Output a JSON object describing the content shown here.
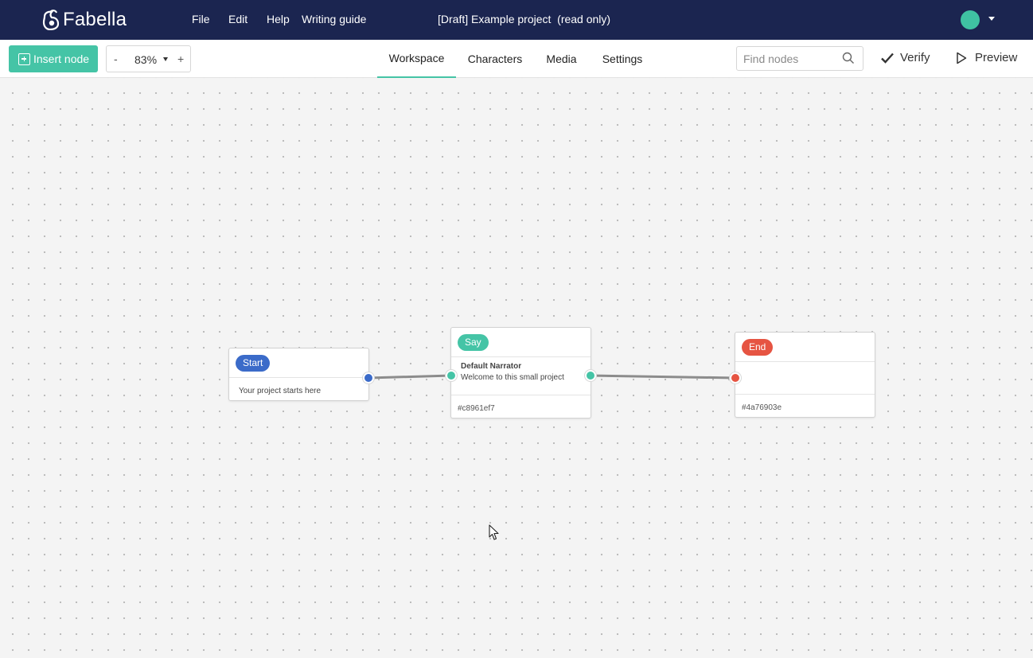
{
  "app": {
    "brand": "Fabella",
    "menu": [
      "File",
      "Edit",
      "Help",
      "Writing guide"
    ],
    "document_title": "[Draft] Example project  (read only)",
    "avatar_color": "#3fc2a2",
    "header_color": "#1b2550",
    "accent_color": "#45c4a6"
  },
  "toolbar": {
    "insert_label": "Insert node",
    "zoom_minus": "-",
    "zoom_value": "83%",
    "zoom_plus": "+",
    "tabs": [
      {
        "label": "Workspace",
        "active": true
      },
      {
        "label": "Characters",
        "active": false
      },
      {
        "label": "Media",
        "active": false
      },
      {
        "label": "Settings",
        "active": false
      }
    ],
    "search_placeholder": "Find nodes",
    "verify_label": "Verify",
    "preview_label": "Preview"
  },
  "nodes": {
    "start": {
      "type": "Start",
      "description": "Your project starts here",
      "color": "#3b6bc9"
    },
    "say": {
      "type": "Say",
      "speaker": "Default Narrator",
      "text": "Welcome to this small project",
      "id": "#c8961ef7",
      "color": "#45c4a6"
    },
    "end": {
      "type": "End",
      "id": "#4a76903e",
      "color": "#e65442"
    }
  },
  "icons": [
    "insert-plus-icon",
    "search-icon",
    "check-icon",
    "play-icon",
    "dropdown-caret-icon",
    "logo-icon"
  ]
}
